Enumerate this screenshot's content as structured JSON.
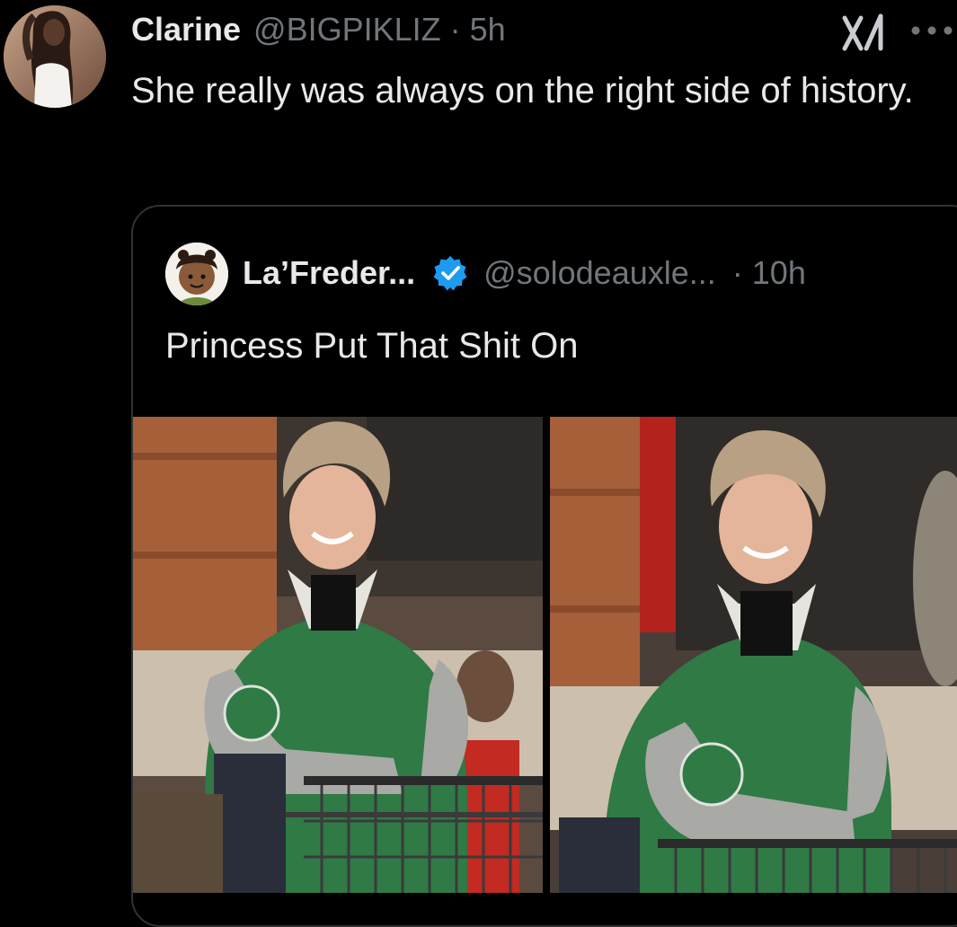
{
  "tweet": {
    "author_name": "Clarine",
    "author_handle": "@BIGPIKLIZ",
    "separator": "·",
    "time": "5h",
    "text": "She really was always on the right side of history.",
    "avatar_icon": "user-avatar",
    "actions": {
      "grok_icon": "grok-icon",
      "more_icon": "more-options-icon"
    }
  },
  "quoted_tweet": {
    "author_name": "La’Freder...",
    "verified_badge": "verified-badge-icon",
    "author_handle": "@solodeauxle...",
    "separator": "·",
    "time": "10h",
    "text": "Princess Put That Shit On",
    "media": [
      {
        "kind": "photo",
        "subject": "woman in green varsity jacket seated at railing"
      },
      {
        "kind": "photo",
        "subject": "woman in green varsity jacket seated at railing, closer crop"
      }
    ]
  },
  "colors": {
    "background": "#000000",
    "text_primary": "#e7e9ea",
    "text_secondary": "#71767b",
    "card_border": "#2f3336",
    "verified_blue": "#1d9bf0"
  }
}
